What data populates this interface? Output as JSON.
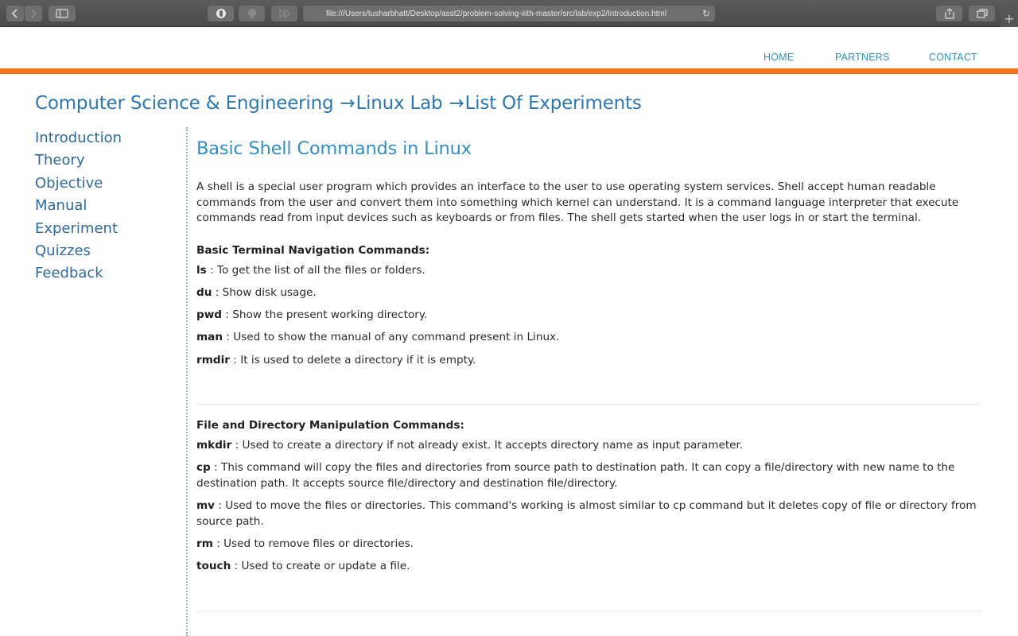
{
  "browser": {
    "url": "file:///Users/tusharbhatt/Desktop/asst2/problem-solving-iiith-master/src/lab/exp2/Introduction.html",
    "back_icon": "chevron-left",
    "forward_icon": "chevron-right",
    "sidebar_icon": "sidebar",
    "reload_icon": "reload",
    "share_icon": "share",
    "tabs_icon": "tabs",
    "new_tab_icon": "plus"
  },
  "topnav": {
    "items": [
      "HOME",
      "PARTNERS",
      "CONTACT"
    ]
  },
  "colors": {
    "accent_orange": "#f6751b",
    "link_blue": "#2f8fc7",
    "breadcrumb_blue": "#2b78b5",
    "sidebar_blue": "#2d6aa0"
  },
  "breadcrumb": {
    "items": [
      "Computer Science & Engineering",
      "Linux Lab",
      "List Of Experiments"
    ],
    "separator": "→"
  },
  "sidebar": {
    "items": [
      "Introduction",
      "Theory",
      "Objective",
      "Manual",
      "Experiment",
      "Quizzes",
      "Feedback"
    ]
  },
  "main": {
    "title": "Basic Shell Commands in Linux",
    "intro": "A shell is a special user program which provides an interface to the user to use operating system services. Shell accept human readable commands from the user and convert them into something which kernel can understand. It is a command language interpreter that execute commands read from input devices such as keyboards or from files. The shell gets started when the user logs in or start the terminal.",
    "sections": [
      {
        "heading": "Basic Terminal Navigation Commands:",
        "commands": [
          {
            "name": "ls",
            "desc": " : To get the list of all the files or folders."
          },
          {
            "name": "du",
            "desc": " : Show disk usage."
          },
          {
            "name": "pwd",
            "desc": " : Show the present working directory."
          },
          {
            "name": "man",
            "desc": " : Used to show the manual of any command present in Linux."
          },
          {
            "name": "rmdir",
            "desc": " : It is used to delete a directory if it is empty."
          }
        ]
      },
      {
        "heading": "File and Directory Manipulation Commands:",
        "commands": [
          {
            "name": "mkdir",
            "desc": " : Used to create a directory if not already exist. It accepts directory name as input parameter."
          },
          {
            "name": "cp",
            "desc": " : This command will copy the files and directories from source path to destination path. It can copy a file/directory with new name to the destination path. It accepts source file/directory and destination file/directory."
          },
          {
            "name": "mv",
            "desc": " : Used to move the files or directories. This command's working is almost similar to cp command but it deletes copy of file or directory from source path."
          },
          {
            "name": "rm",
            "desc": " : Used to remove files or directories."
          },
          {
            "name": "touch",
            "desc": " : Used to create or update a file."
          }
        ]
      }
    ]
  }
}
